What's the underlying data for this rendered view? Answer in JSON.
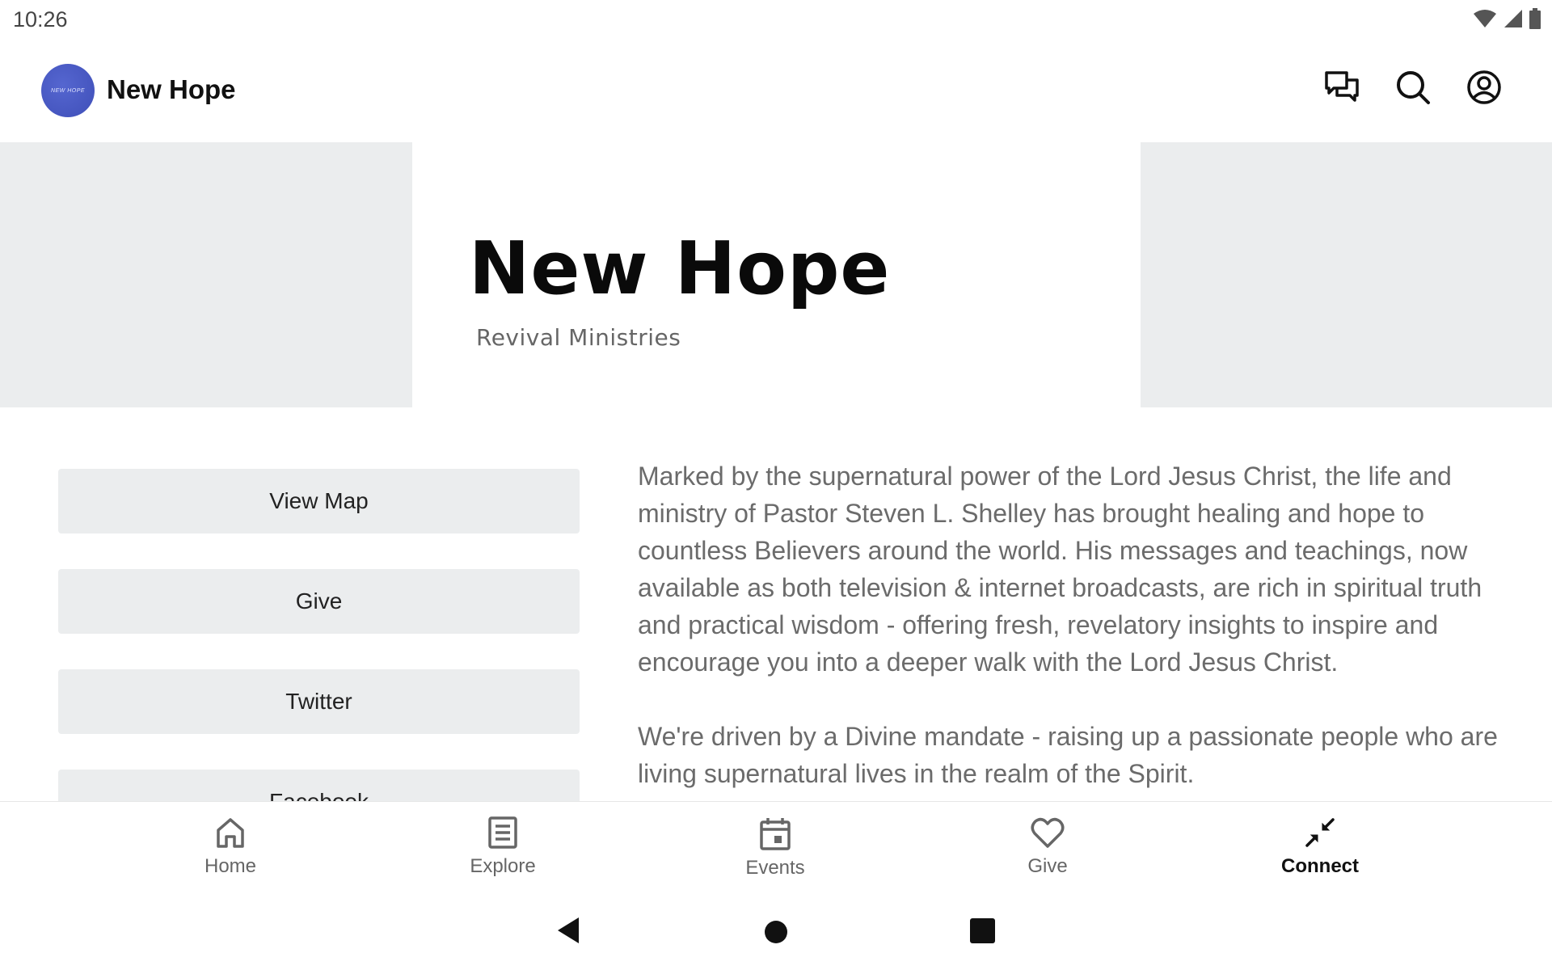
{
  "status_bar": {
    "time": "10:26"
  },
  "app_bar": {
    "title": "New Hope",
    "logo_text": "NEW HOPE",
    "actions": [
      "chat-icon",
      "search-icon",
      "account-icon"
    ]
  },
  "hero": {
    "title": "New Hope",
    "subtitle": "Revival Ministries"
  },
  "links": [
    {
      "label": "View Map"
    },
    {
      "label": "Give"
    },
    {
      "label": "Twitter"
    },
    {
      "label": "Facebook"
    }
  ],
  "description": {
    "paragraph1": "Marked by the supernatural power of the Lord Jesus Christ, the life and ministry of Pastor Steven L. Shelley has brought healing and hope to countless Believers around the world. His messages and teachings, now available as both television & internet broadcasts, are rich in spiritual truth and practical wisdom - offering fresh, revelatory insights to inspire and encourage you into a deeper walk with the Lord Jesus Christ.",
    "paragraph2": "We're driven by a Divine mandate - raising up a passionate people who are living supernatural lives in the realm of the Spirit."
  },
  "bottom_nav": {
    "items": [
      {
        "label": "Home",
        "icon": "home-icon"
      },
      {
        "label": "Explore",
        "icon": "explore-icon"
      },
      {
        "label": "Events",
        "icon": "calendar-icon"
      },
      {
        "label": "Give",
        "icon": "heart-icon"
      },
      {
        "label": "Connect",
        "icon": "connect-icon",
        "active": true
      }
    ]
  },
  "colors": {
    "accent": "#111111",
    "inactive": "#666666",
    "button_bg": "#ebedee",
    "logo": "#4453bf"
  }
}
